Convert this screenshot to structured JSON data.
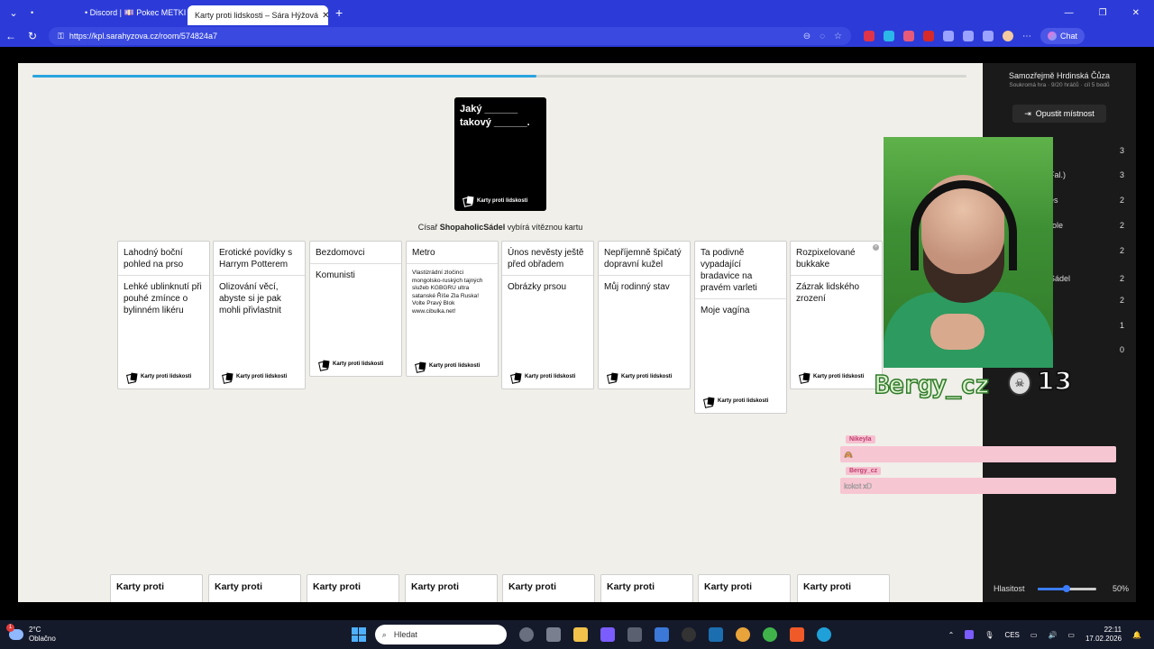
{
  "browser": {
    "tabs": [
      {
        "label": "•"
      },
      {
        "label": "• Discord | 💷 Pokec METKI 🔳"
      },
      {
        "label": "Karty proti lidskosti – Sára Hýžová"
      }
    ],
    "url": "https://kpl.sarahyzova.cz/room/574824a7",
    "chat_label": "Chat"
  },
  "game": {
    "progress_percent": 54,
    "black_card": {
      "text": "Jaký ______ takový ______.",
      "brand": "Karty proti lidskosti"
    },
    "czar_prefix": "Císař ",
    "czar_name": "ShopaholicSádel",
    "czar_suffix": " vybírá vítěznou kartu",
    "brand": "Karty proti lidskosti",
    "stacks": [
      {
        "top": "Lahodný boční pohled na prso",
        "bottom": "Lehké ublinknutí při pouhé zmínce o bylinném likéru"
      },
      {
        "top": "Erotické povídky s Harrym Potterem",
        "bottom": "Olizování věcí, abyste si je pak mohli přivlastnit"
      },
      {
        "top": "Bezdomovci",
        "bottom": "Komunisti"
      },
      {
        "top": "Metro",
        "bottom": "Vlastizrádní zločinci mongolsko-ruských tajných služeb KGBGRU ultra satanské Říše Zla Ruska! Volte Pravý Blok www.cibulka.net!"
      },
      {
        "top": "Únos nevěsty ještě před obřadem",
        "bottom": "Obrázky prsou"
      },
      {
        "top": "Nepříjemně špičatý dopravní kužel",
        "bottom": "Můj rodinný stav"
      },
      {
        "top": "Ta podivně vypadající bradavice na pravém varleti",
        "bottom": "Moje vagína"
      },
      {
        "top": "Rozpixelované bukkake",
        "bottom": "Zázrak lidského zrození"
      }
    ],
    "hand_label": "Karty proti"
  },
  "sidebar": {
    "room_title": "Samozřejmě Hrdinská Čůza",
    "room_sub": "Soukromá hra · 9/20 hráčů · cíl 5 bodů",
    "leave_label": "Opustit místnost",
    "scores": [
      {
        "name": "",
        "points": "3"
      },
      {
        "name": "Fal.)",
        "points": "3"
      },
      {
        "name": "es",
        "points": "2"
      },
      {
        "name": "role",
        "points": "2"
      },
      {
        "name": "",
        "points": "2"
      },
      {
        "name": "Sádel",
        "points": "2"
      },
      {
        "name": "",
        "points": "2"
      },
      {
        "name": "",
        "points": "1"
      },
      {
        "name": "",
        "points": "0"
      }
    ],
    "volume_label": "Hlasitost",
    "volume_value": "50%",
    "volume_level": 0.5
  },
  "stream": {
    "streamer": "Bergy_cz",
    "counter": "13",
    "chat": [
      {
        "name": "Nikeyla",
        "message": "🙈"
      },
      {
        "name": "Bergy_cz",
        "message": "kokot xD"
      }
    ]
  },
  "taskbar": {
    "temp": "2°C",
    "weather": "Oblačno",
    "badge": "1",
    "search_placeholder": "Hledat",
    "lang": "CES",
    "time": "22:11",
    "date": "17.02.2026"
  }
}
